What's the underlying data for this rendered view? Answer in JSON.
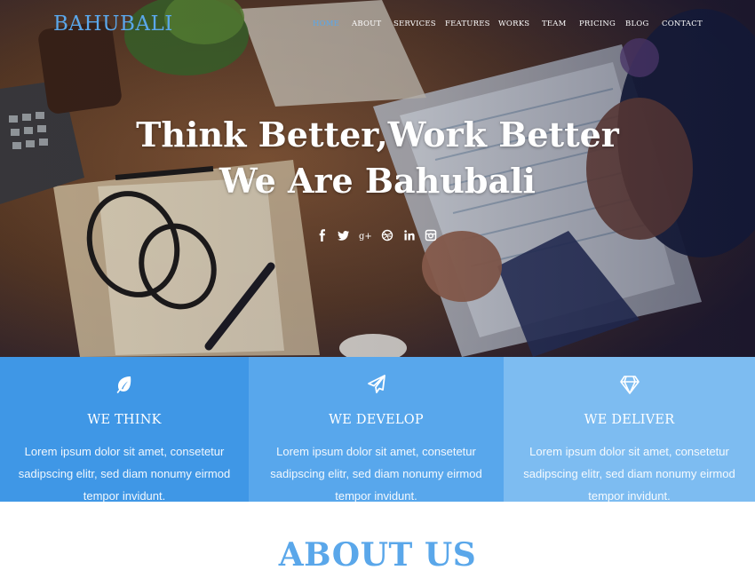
{
  "brand": {
    "name": "BAHUBALI"
  },
  "nav": {
    "items": [
      {
        "label": "HOME",
        "active": true
      },
      {
        "label": "ABOUT",
        "active": false
      },
      {
        "label": "SERVICES",
        "active": false
      },
      {
        "label": "FEATURES",
        "active": false
      },
      {
        "label": "WORKS",
        "active": false
      },
      {
        "label": "TEAM",
        "active": false
      },
      {
        "label": "PRICING",
        "active": false
      },
      {
        "label": "BLOG",
        "active": false
      },
      {
        "label": "CONTACT",
        "active": false
      }
    ]
  },
  "hero": {
    "title_line1": "Think Better,Work Better",
    "title_line2": "We Are Bahubali",
    "social_icons": [
      "facebook-icon",
      "twitter-icon",
      "google-plus-icon",
      "dribbble-icon",
      "linkedin-icon",
      "instagram-icon"
    ]
  },
  "features": [
    {
      "icon": "leaf-icon",
      "title": "WE THINK",
      "text": "Lorem ipsum dolor sit amet, consetetur sadipscing elitr, sed diam nonumy eirmod tempor invidunt.",
      "color": "#3f97e6"
    },
    {
      "icon": "paper-plane-icon",
      "title": "WE DEVELOP",
      "text": "Lorem ipsum dolor sit amet, consetetur sadipscing elitr, sed diam nonumy eirmod tempor invidunt.",
      "color": "#58a7ec"
    },
    {
      "icon": "diamond-icon",
      "title": "WE DELIVER",
      "text": "Lorem ipsum dolor sit amet, consetetur sadipscing elitr, sed diam nonumy eirmod tempor invidunt.",
      "color": "#7dbcf1"
    }
  ],
  "about": {
    "title": "ABOUT US"
  },
  "colors": {
    "accent": "#5aa7ea",
    "white": "#ffffff"
  }
}
